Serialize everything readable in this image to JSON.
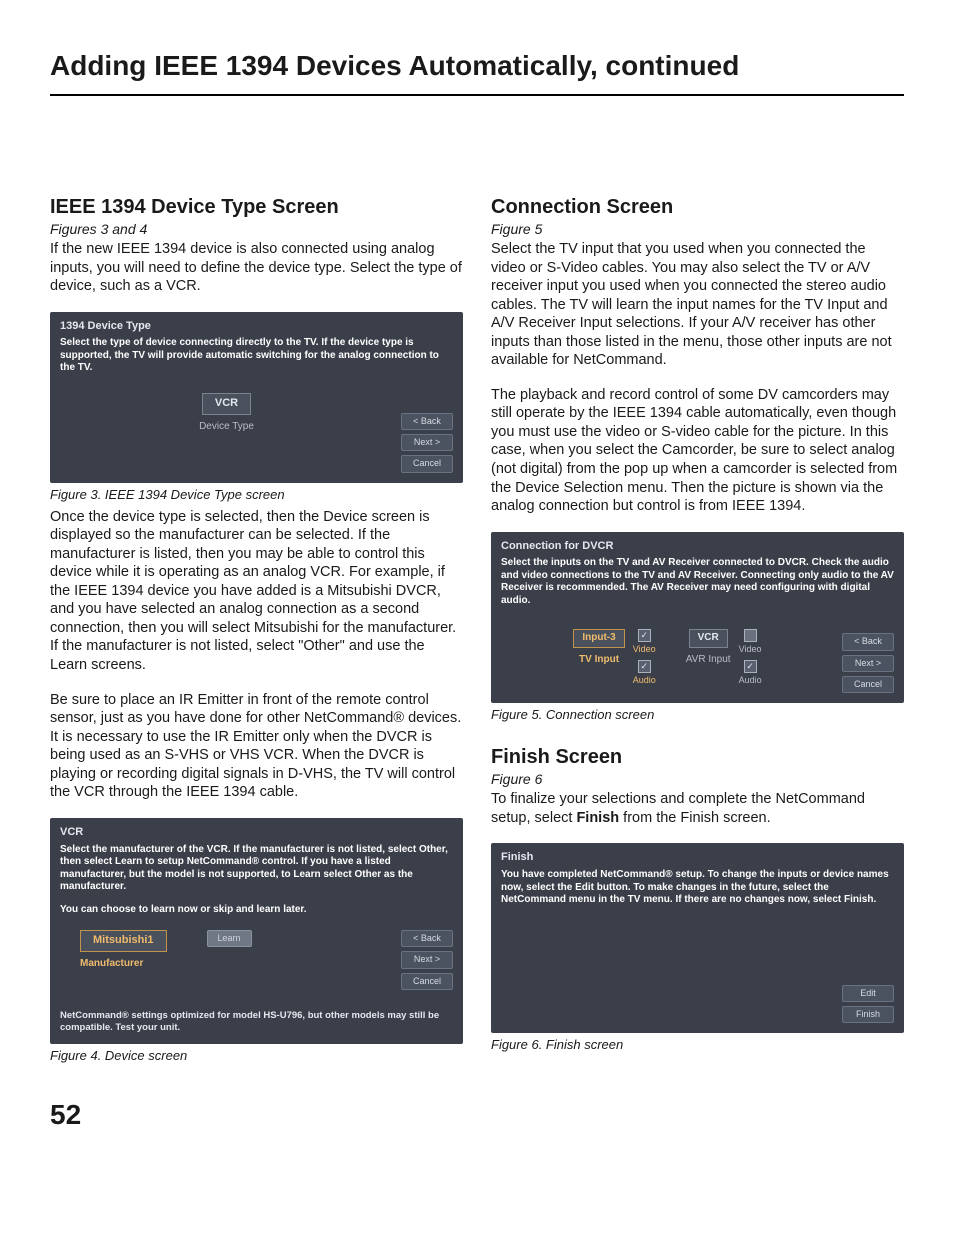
{
  "page_title": "Adding IEEE 1394 Devices Automatically, continued",
  "page_number": "52",
  "left": {
    "heading1": "IEEE 1394 Device Type Screen",
    "figref1": "Figures 3 and 4",
    "para1": "If the new IEEE 1394 device is also connected using analog inputs, you will need to define the device type. Select the type of device, such as a VCR.",
    "fig3_caption": "Figure 3. IEEE 1394 Device Type screen",
    "para2": "Once the device type is selected, then the Device screen is displayed so the manufacturer can be selected. If the manufacturer is listed, then you may be able to control this device while it is operating as an analog VCR.  For example, if the IEEE 1394 device you have added is a Mitsubishi DVCR, and you have selected an analog connection as a second connection, then you will select Mitsubishi for the manufacturer.  If the manufacturer is not listed, select \"Other\" and use the Learn screens.",
    "para3": "Be sure to place an IR Emitter in front of the remote control sensor, just as you have done for other NetCommand® devices.  It is necessary to use the IR Emitter only when the DVCR is being used as an S-VHS or VHS VCR.  When the DVCR is playing or recording digital signals in D-VHS, the TV will control the VCR through the IEEE 1394 cable.",
    "fig4_caption": "Figure 4.  Device  screen",
    "shot3": {
      "title": "1394 Device Type",
      "desc": "Select the type of device connecting directly to the TV.  If the device type is supported, the TV will provide automatic switching for the analog connection to the TV.",
      "field_value": "VCR",
      "field_label": "Device Type",
      "buttons": [
        "< Back",
        "Next >",
        "Cancel"
      ]
    },
    "shot4": {
      "title": "VCR",
      "desc": "Select the manufacturer of the VCR.   If the manufacturer is not listed, select Other, then select Learn to setup NetCommand® control. If you have a listed manufacturer, but the model is not supported, to Learn select Other as the manufacturer.",
      "sub": "You can choose to learn now or skip and learn later.",
      "field_value": "Mitsubishi1",
      "field_label": "Manufacturer",
      "learn_btn": "Learn",
      "footer": "NetCommand® settings optimized for model HS-U796, but other models may still be compatible. Test your unit.",
      "buttons": [
        "< Back",
        "Next >",
        "Cancel"
      ]
    }
  },
  "right": {
    "heading1": "Connection Screen",
    "figref1": "Figure 5",
    "para1": "Select the TV input that you used when you connected the video or S-Video cables.  You may also select the TV or A/V receiver input you used when you connected the stereo audio cables.  The TV will learn the input names for the TV Input and A/V Receiver Input selections.  If your A/V receiver has other inputs than those listed in the menu, those other inputs are not available for NetCommand.",
    "para2": "The playback and record control of some DV camcorders may still operate by the IEEE 1394 cable automatically, even though you must use the video or S-video cable for the picture.  In this case, when you select the Camcorder, be sure to select analog (not digital) from the pop up when a camcorder is selected from the Device Selection menu.  Then the picture is shown via the analog connection but control is from IEEE 1394.",
    "fig5_caption": "Figure 5. Connection screen",
    "shot5": {
      "title": "Connection for DVCR",
      "desc": "Select the inputs on the TV and AV Receiver connected to DVCR.  Check the audio and video connections to the TV and AV Receiver.  Connecting only audio to the AV Receiver is recommended.  The AV Receiver may need configuring with digital audio.",
      "tv_field": "Input-3",
      "tv_label": "TV Input",
      "tv_video": "Video",
      "tv_audio": "Audio",
      "avr_field": "VCR",
      "avr_label": "AVR Input",
      "avr_video": "Video",
      "avr_audio": "Audio",
      "buttons": [
        "< Back",
        "Next >",
        "Cancel"
      ]
    },
    "heading2": "Finish Screen",
    "figref2": "Figure 6",
    "para3a": "To finalize your selections and complete the NetCommand setup, select ",
    "para3b": "Finish",
    "para3c": " from the Finish screen.",
    "fig6_caption": "Figure 6. Finish screen",
    "shot6": {
      "title": "Finish",
      "desc": "You have completed NetCommand® setup.  To change the inputs or device names now, select the Edit button.  To make changes in the future, select the NetCommand menu in the TV menu.  If there are no changes now, select Finish.",
      "buttons": [
        "Edit",
        "Finish"
      ]
    }
  }
}
